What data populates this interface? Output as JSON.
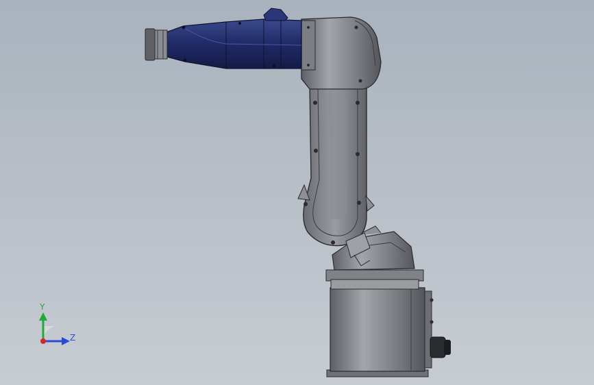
{
  "viewport": {
    "background_top": "#a9b2bd",
    "background_bottom": "#c7ccd2"
  },
  "model": {
    "arm_color": "#1f2a66",
    "body_color": "#8c8e93",
    "edge_color": "#2a2b30"
  },
  "triad": {
    "y_label": "Y",
    "z_label": "Z",
    "y_color": "#1eab3a",
    "z_color": "#2b4bd6",
    "x_color": "#d62828"
  }
}
